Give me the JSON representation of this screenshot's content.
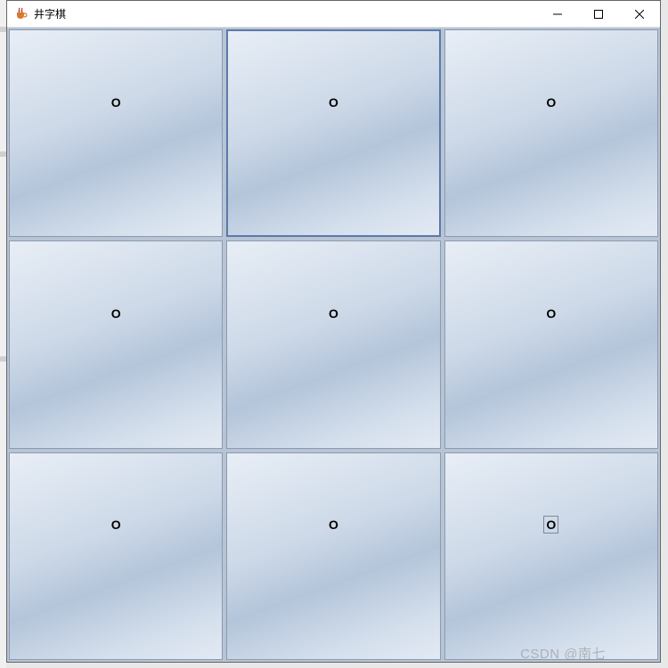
{
  "window": {
    "title": "井字棋",
    "buttons": {
      "minimize": "minimize",
      "maximize": "maximize",
      "close": "close"
    }
  },
  "board": {
    "cells": [
      {
        "value": "O",
        "highlight": false,
        "focused": false
      },
      {
        "value": "O",
        "highlight": true,
        "focused": false
      },
      {
        "value": "O",
        "highlight": false,
        "focused": false
      },
      {
        "value": "O",
        "highlight": false,
        "focused": false
      },
      {
        "value": "O",
        "highlight": false,
        "focused": false
      },
      {
        "value": "O",
        "highlight": false,
        "focused": false
      },
      {
        "value": "O",
        "highlight": false,
        "focused": false
      },
      {
        "value": "O",
        "highlight": false,
        "focused": false
      },
      {
        "value": "O",
        "highlight": false,
        "focused": true
      }
    ]
  },
  "watermark": "CSDN @南七",
  "icons": {
    "app": "java-cup-icon",
    "minimize": "minimize-icon",
    "maximize": "maximize-icon",
    "close": "close-icon"
  }
}
